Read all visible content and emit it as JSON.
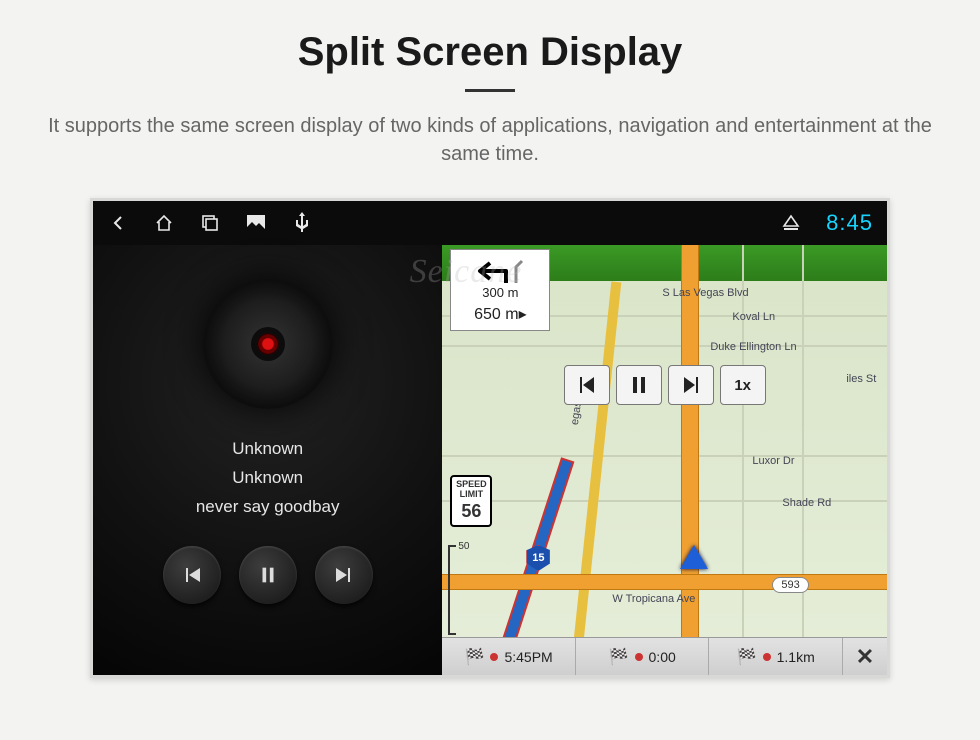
{
  "hero": {
    "title": "Split Screen Display",
    "description": "It supports the same screen display of two kinds of applications, navigation and entertainment at the same time."
  },
  "status_bar": {
    "time": "8:45"
  },
  "watermark": "Seicane",
  "player": {
    "line1": "Unknown",
    "line2": "Unknown",
    "line3": "never say goodbay"
  },
  "nav": {
    "turn_distance_top": "300 m",
    "turn_distance_main": "650 m",
    "playback_speed": "1x",
    "street_top": "S Las Vegas Blvd",
    "street_koval": "Koval Ln",
    "street_duke": "Duke Ellington Ln",
    "street_vegas": "egas Blvd",
    "street_luxor": "Luxor Dr",
    "street_shade": "Shade Rd",
    "street_trop": "W Tropicana Ave",
    "street_iles": "iles St",
    "speed_label": "SPEED LIMIT",
    "speed_value": "56",
    "shield": "15",
    "scale": "50",
    "route_num": "593",
    "footer_eta": "5:45PM",
    "footer_time": "0:00",
    "footer_dist": "1.1km"
  }
}
